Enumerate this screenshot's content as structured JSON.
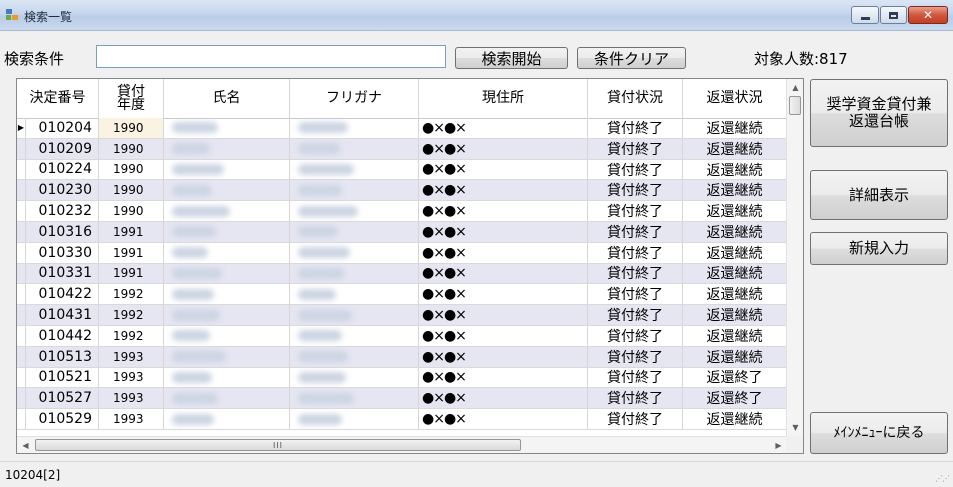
{
  "window": {
    "title": "検索一覧"
  },
  "search": {
    "label": "検索条件",
    "value": "",
    "search_button": "検索開始",
    "clear_button": "条件クリア",
    "count_text": "対象人数:817"
  },
  "grid": {
    "columns": [
      "決定番号",
      "貸付\n年度",
      "氏名",
      "フリガナ",
      "現住所",
      "貸付状況",
      "返還状況"
    ],
    "rows": [
      {
        "no": "010204",
        "year": "1990",
        "addr": "●×●×",
        "lend": "貸付終了",
        "repay": "返還継続"
      },
      {
        "no": "010209",
        "year": "1990",
        "addr": "●×●×",
        "lend": "貸付終了",
        "repay": "返還継続"
      },
      {
        "no": "010224",
        "year": "1990",
        "addr": "●×●×",
        "lend": "貸付終了",
        "repay": "返還継続"
      },
      {
        "no": "010230",
        "year": "1990",
        "addr": "●×●×",
        "lend": "貸付終了",
        "repay": "返還継続"
      },
      {
        "no": "010232",
        "year": "1990",
        "addr": "●×●×",
        "lend": "貸付終了",
        "repay": "返還継続"
      },
      {
        "no": "010316",
        "year": "1991",
        "addr": "●×●×",
        "lend": "貸付終了",
        "repay": "返還継続"
      },
      {
        "no": "010330",
        "year": "1991",
        "addr": "●×●×",
        "lend": "貸付終了",
        "repay": "返還継続"
      },
      {
        "no": "010331",
        "year": "1991",
        "addr": "●×●×",
        "lend": "貸付終了",
        "repay": "返還継続"
      },
      {
        "no": "010422",
        "year": "1992",
        "addr": "●×●×",
        "lend": "貸付終了",
        "repay": "返還継続"
      },
      {
        "no": "010431",
        "year": "1992",
        "addr": "●×●×",
        "lend": "貸付終了",
        "repay": "返還継続"
      },
      {
        "no": "010442",
        "year": "1992",
        "addr": "●×●×",
        "lend": "貸付終了",
        "repay": "返還継続"
      },
      {
        "no": "010513",
        "year": "1993",
        "addr": "●×●×",
        "lend": "貸付終了",
        "repay": "返還継続"
      },
      {
        "no": "010521",
        "year": "1993",
        "addr": "●×●×",
        "lend": "貸付終了",
        "repay": "返還終了"
      },
      {
        "no": "010527",
        "year": "1993",
        "addr": "●×●×",
        "lend": "貸付終了",
        "repay": "返還終了"
      },
      {
        "no": "010529",
        "year": "1993",
        "addr": "●×●×",
        "lend": "貸付終了",
        "repay": "返還継続"
      }
    ],
    "selected_row": 0,
    "hscroll_label": "III"
  },
  "side": {
    "ledger_button": "奨学資金貸付兼\n返還台帳",
    "detail_button": "詳細表示",
    "new_button": "新規入力",
    "menu_button": "ﾒｲﾝﾒﾆｭｰに戻る"
  },
  "status": {
    "text": "10204[2]"
  },
  "icons": {
    "app": "app-window-icon",
    "minimize": "minimize-icon",
    "maximize": "maximize-icon",
    "close": "close-icon"
  }
}
